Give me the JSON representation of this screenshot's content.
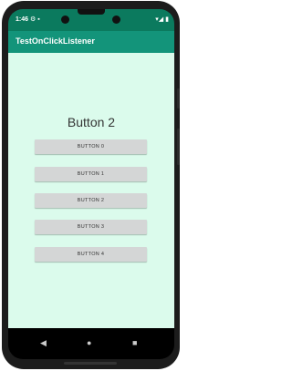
{
  "status_bar": {
    "time": "1:46",
    "left_icons": "⚙ ▪",
    "right_icons": "▾◢ ▮"
  },
  "app_bar": {
    "title": "TestOnClickListener"
  },
  "main": {
    "result_text": "Button 2",
    "buttons": [
      "BUTTON 0",
      "BUTTON 1",
      "BUTTON 2",
      "BUTTON 3",
      "BUTTON 4"
    ]
  },
  "nav_bar": {
    "back": "◀",
    "home": "●",
    "recents": "■"
  },
  "colors": {
    "status_bar": "#0b7a5e",
    "app_bar": "#13947a",
    "content_bg": "#dbfbec",
    "button_bg": "#d4d6d6"
  }
}
